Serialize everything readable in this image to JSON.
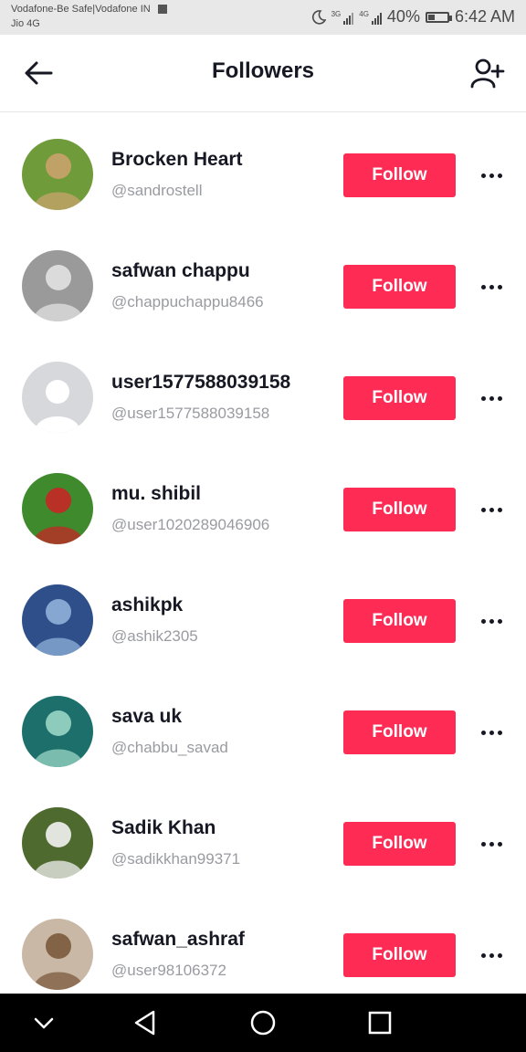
{
  "status_bar": {
    "carrier_line1": "Vodafone-Be Safe|Vodafone IN",
    "carrier_line2": "Jio 4G",
    "net1": "3G",
    "net2": "4G",
    "battery": "40%",
    "battery_level": 0.4,
    "time": "6:42 AM"
  },
  "header": {
    "title": "Followers",
    "back_icon": "arrow-left-icon",
    "add_icon": "add-user-icon"
  },
  "followers": [
    {
      "name": "Brocken Heart",
      "handle": "@sandrostell",
      "button": "Follow",
      "avatar": "photo",
      "colors": [
        "#6f9b3a",
        "#c9a36d"
      ]
    },
    {
      "name": "safwan chappu",
      "handle": "@chappuchappu8466",
      "button": "Follow",
      "avatar": "photo",
      "colors": [
        "#9a9a9a",
        "#e2e2e2"
      ]
    },
    {
      "name": "user1577588039158",
      "handle": "@user1577588039158",
      "button": "Follow",
      "avatar": "default",
      "colors": [
        "#d7d8dc",
        "#ffffff"
      ]
    },
    {
      "name": "mu. shibil",
      "handle": "@user1020289046906",
      "button": "Follow",
      "avatar": "photo",
      "colors": [
        "#3f8a2c",
        "#c62626"
      ]
    },
    {
      "name": "ashikpk",
      "handle": "@ashik2305",
      "button": "Follow",
      "avatar": "photo",
      "colors": [
        "#2e4f8a",
        "#8fb0d8"
      ]
    },
    {
      "name": "sava uk",
      "handle": "@chabbu_savad",
      "button": "Follow",
      "avatar": "photo",
      "colors": [
        "#1c6f6a",
        "#9ad6c6"
      ]
    },
    {
      "name": "Sadik Khan",
      "handle": "@sadikkhan99371",
      "button": "Follow",
      "avatar": "photo",
      "colors": [
        "#4f6a2e",
        "#f2f2f2"
      ]
    },
    {
      "name": "safwan_ashraf",
      "handle": "@user98106372",
      "button": "Follow",
      "avatar": "photo",
      "colors": [
        "#c9b8a6",
        "#7a5a3c"
      ]
    }
  ],
  "nav_bar": {
    "buttons": [
      "chevron-down-icon",
      "back-triangle-icon",
      "home-circle-icon",
      "recents-square-icon"
    ]
  },
  "colors": {
    "accent": "#fe2c55",
    "text": "#161823",
    "subtext": "#9a9ba1"
  }
}
